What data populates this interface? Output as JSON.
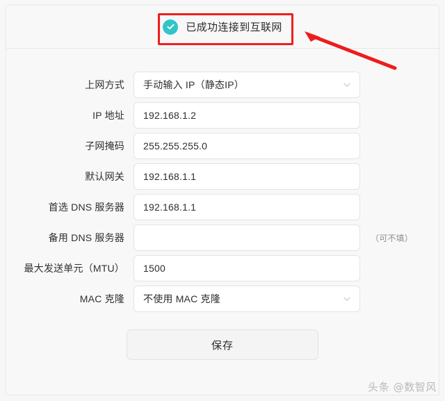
{
  "banner": {
    "icon": "check-circle-icon",
    "text": "已成功连接到互联网",
    "icon_color": "#32c5c8"
  },
  "form": {
    "rows": [
      {
        "label": "上网方式",
        "value": "手动输入 IP（静态IP）",
        "type": "select",
        "hint": ""
      },
      {
        "label": "IP 地址",
        "value": "192.168.1.2",
        "type": "input",
        "hint": ""
      },
      {
        "label": "子网掩码",
        "value": "255.255.255.0",
        "type": "input",
        "hint": ""
      },
      {
        "label": "默认网关",
        "value": "192.168.1.1",
        "type": "input",
        "hint": ""
      },
      {
        "label": "首选 DNS 服务器",
        "value": "192.168.1.1",
        "type": "input",
        "hint": ""
      },
      {
        "label": "备用 DNS 服务器",
        "value": "",
        "type": "input",
        "hint": "（可不填）"
      },
      {
        "label": "最大发送单元（MTU）",
        "value": "1500",
        "type": "input",
        "hint": ""
      },
      {
        "label": "MAC 克隆",
        "value": "不使用 MAC 克隆",
        "type": "select",
        "hint": ""
      }
    ]
  },
  "actions": {
    "save_label": "保存"
  },
  "annotations": {
    "highlight_color": "#f01d1d",
    "arrow_color": "#ee1c1c"
  },
  "watermark": {
    "text": "头条 @数智风"
  }
}
